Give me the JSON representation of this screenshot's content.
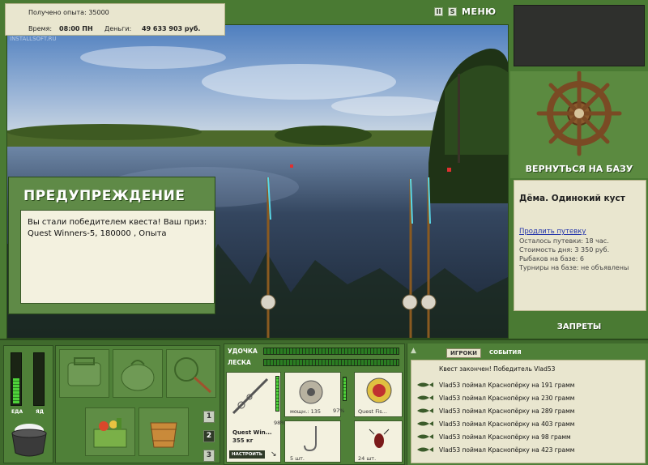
{
  "status": {
    "experience": "Получено опыта: 35000",
    "time_label": "Время:",
    "time_value": "08:00 ПН",
    "money_label": "Деньги:",
    "money_value": "49 633 903 руб."
  },
  "watermark": "INSTALLSOFT.RU",
  "top_buttons": {
    "pause": "II",
    "sound": "S",
    "menu": "МЕНЮ"
  },
  "warning": {
    "title": "ПРЕДУПРЕЖДЕНИЕ",
    "message": "Вы стали победителем квеста! Ваш приз: Quest Winners-5, 180000 , Опыта"
  },
  "base": {
    "back_button": "ВЕРНУТЬСЯ НА БАЗУ",
    "location": "Дёма. Одинокий куст",
    "extend_link": "Продлить путевку",
    "lines": [
      "Осталось путевки: 18 час.",
      "Стоимость дня: 3 350 руб.",
      "Рыбаков на базе: 6",
      "Турниры на базе: не объявлены"
    ],
    "bans": "ЗАПРЕТЫ"
  },
  "gauges": {
    "food_label": "ЕДА",
    "food_level": 0.55,
    "poison_label": "ЯД",
    "poison_level": 0.0
  },
  "inventory": {
    "pages": [
      "1",
      "2",
      "3"
    ],
    "active_page": "2"
  },
  "tackle": {
    "rod_label": "УДОЧКА",
    "line_label": "ЛЕСКА",
    "rod_name": "Quest Win...",
    "rod_weight": "355 кг",
    "rod_percent": "98%",
    "adjust_button": "НАСТРОИТЬ",
    "reel_power": "мощн.: 135",
    "reel_percent": "97%",
    "line_name": "Quest Fis...",
    "hook_count": "5 шт.",
    "bait_count": "24 шт."
  },
  "log": {
    "tabs": [
      "ИГРОКИ",
      "СОБЫТИЯ"
    ],
    "active_tab": "ИГРОКИ",
    "header": "Квест закончен! Победитель Vlad53",
    "entries": [
      "Vlad53 поймал Краснопёрку на 191 грамм",
      "Vlad53 поймал Краснопёрку на 230 грамм",
      "Vlad53 поймал Краснопёрку на 289 грамм",
      "Vlad53 поймал Краснопёрку на 403 грамм",
      "Vlad53 поймал Краснопёрку на 98 грамм",
      "Vlad53 поймал Краснопёрку на 423 грамм"
    ]
  }
}
